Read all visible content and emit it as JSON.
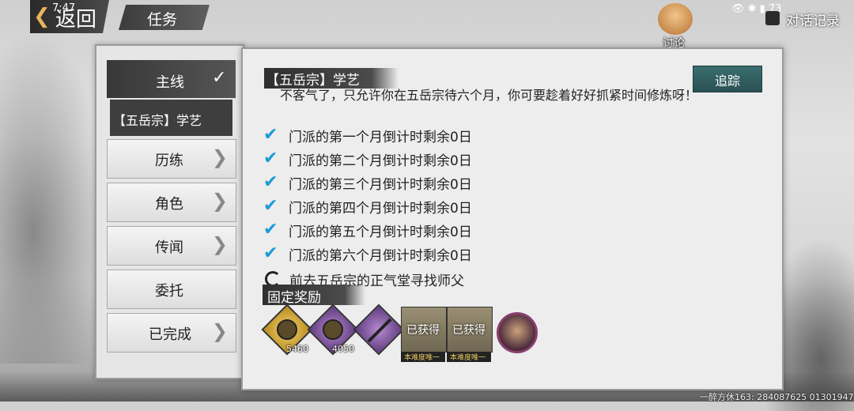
{
  "topbar": {
    "clock": "7:47",
    "back_label": "返回",
    "title": "任务",
    "discuss_label": "讨论",
    "status_battery": "73",
    "dialog_log_label": "对话记录"
  },
  "sidebar": {
    "main_label": "主线",
    "sub_item": "【五岳宗】学艺",
    "items": [
      {
        "label": "历练",
        "has_chevron": true
      },
      {
        "label": "角色",
        "has_chevron": true
      },
      {
        "label": "传闻",
        "has_chevron": true
      },
      {
        "label": "委托",
        "has_chevron": false
      },
      {
        "label": "已完成",
        "has_chevron": true
      }
    ]
  },
  "quest": {
    "title": "【五岳宗】学艺",
    "track_label": "追踪",
    "description": "不客气了，只允许你在五岳宗待六个月，你可要趁着好好抓紧时间修炼呀！",
    "objectives": [
      "门派的第一个月倒计时剩余0日",
      "门派的第二个月倒计时剩余0日",
      "门派的第三个月倒计时剩余0日",
      "门派的第四个月倒计时剩余0日",
      "门派的第五个月倒计时剩余0日",
      "门派的第六个月倒计时剩余0日"
    ],
    "pending_objective": "前去五岳宗的正气堂寻找师父",
    "reward_title": "固定奖励",
    "rewards": [
      {
        "icon": "gold-coin-icon",
        "qty": "5460"
      },
      {
        "icon": "purple-coin-icon",
        "qty": "4050"
      },
      {
        "icon": "sword-icon",
        "qty": ""
      }
    ],
    "obtained_label": "已获得",
    "obtained_tag": "本难度唯一"
  },
  "footer": {
    "watermark": "一醉方休163: 284087625 01301947"
  },
  "colors": {
    "accent_teal": "#2f5f61",
    "check_blue": "#1c9ad6",
    "dark_tab": "#3e3e3e"
  }
}
